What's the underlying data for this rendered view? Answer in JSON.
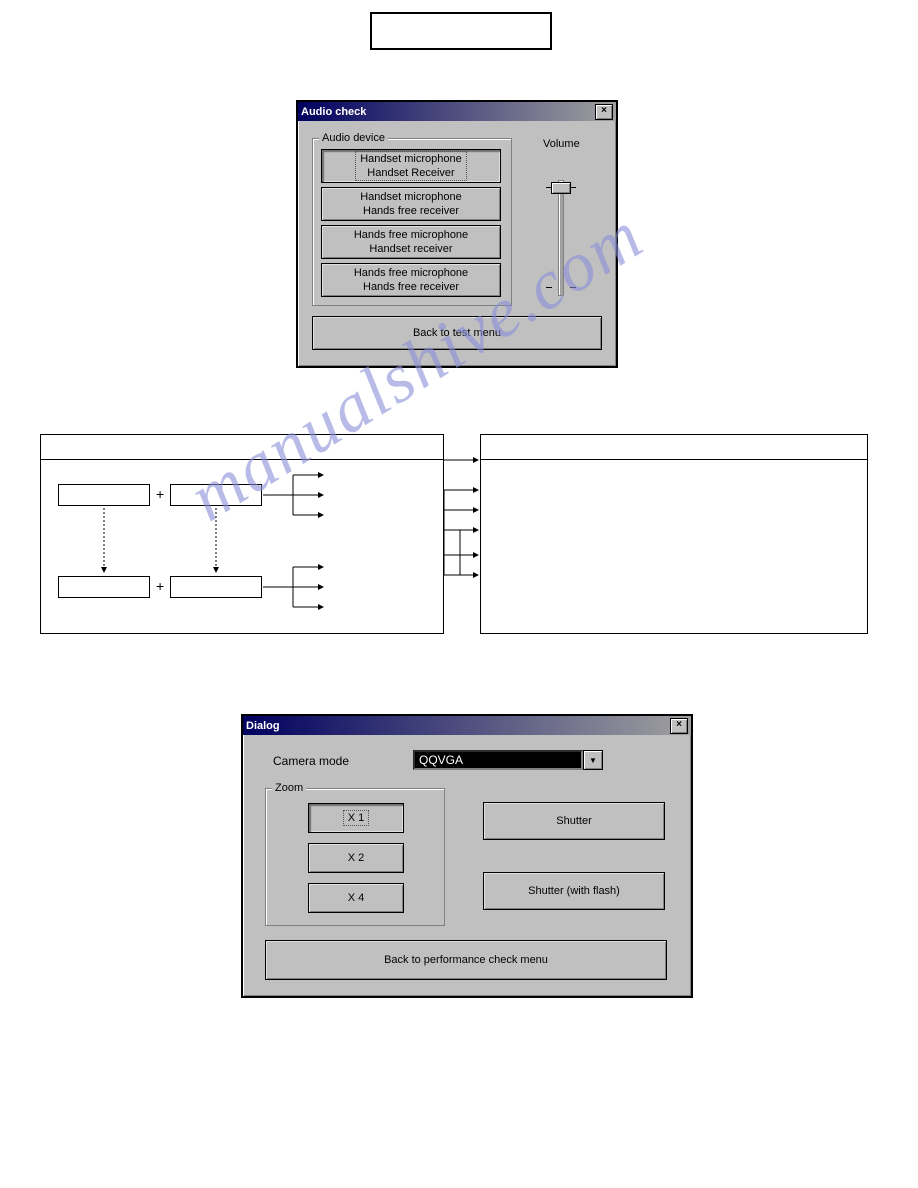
{
  "audio_dialog": {
    "title": "Audio check",
    "group_label": "Audio device",
    "volume_label": "Volume",
    "devices": [
      {
        "line1": "Handset microphone",
        "line2": "Handset Receiver",
        "selected": true
      },
      {
        "line1": "Handset microphone",
        "line2": "Hands free receiver",
        "selected": false
      },
      {
        "line1": "Hands free microphone",
        "line2": "Handset receiver",
        "selected": false
      },
      {
        "line1": "Hands free microphone",
        "line2": "Hands free receiver",
        "selected": false
      }
    ],
    "back_label": "Back to test menu"
  },
  "camera_dialog": {
    "title": "Dialog",
    "camera_mode_label": "Camera mode",
    "camera_mode_value": "QQVGA",
    "zoom_group_label": "Zoom",
    "zoom_options": [
      {
        "label": "X 1",
        "selected": true
      },
      {
        "label": "X 2",
        "selected": false
      },
      {
        "label": "X 4",
        "selected": false
      }
    ],
    "shutter_label": "Shutter",
    "shutter_flash_label": "Shutter (with flash)",
    "back_label": "Back to performance check menu"
  },
  "icons": {
    "close": "×",
    "dropdown": "▼"
  },
  "watermark_text": "manualshive.com"
}
